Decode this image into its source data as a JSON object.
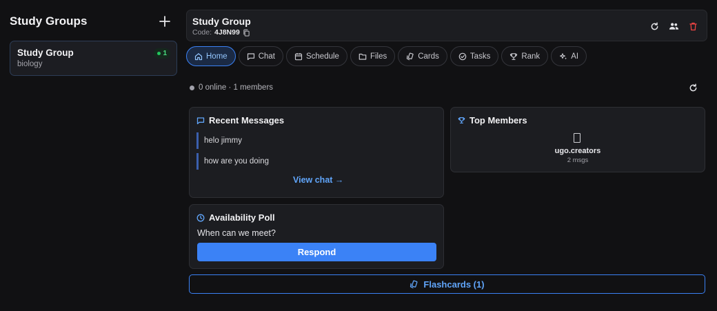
{
  "sidebar": {
    "title": "Study Groups",
    "add_icon": "plus-icon",
    "groups": [
      {
        "name": "Study Group",
        "subject": "biology",
        "online_count": "1"
      }
    ]
  },
  "header": {
    "title": "Study Group",
    "code_label": "Code:",
    "code_value": "4J8N99",
    "icons": [
      "refresh-icon",
      "members-icon",
      "trash-icon"
    ]
  },
  "tabs": [
    {
      "label": "Home",
      "icon": "home-icon",
      "active": true
    },
    {
      "label": "Chat",
      "icon": "chat-icon"
    },
    {
      "label": "Schedule",
      "icon": "calendar-icon"
    },
    {
      "label": "Files",
      "icon": "folder-icon"
    },
    {
      "label": "Cards",
      "icon": "cards-icon"
    },
    {
      "label": "Tasks",
      "icon": "check-circle-icon"
    },
    {
      "label": "Rank",
      "icon": "trophy-icon"
    },
    {
      "label": "AI",
      "icon": "sparkles-icon"
    }
  ],
  "status": {
    "text": "0 online · 1 members"
  },
  "recent_messages": {
    "title": "Recent Messages",
    "messages": [
      "helo jimmy",
      "how are you doing"
    ],
    "view_chat": "View chat →"
  },
  "top_members": {
    "title": "Top Members",
    "members": [
      {
        "name": "ugo.creators",
        "msgs": "2 msgs"
      }
    ]
  },
  "poll": {
    "title": "Availability Poll",
    "question": "When can we meet?",
    "respond_label": "Respond"
  },
  "flashcards": {
    "label": "Flashcards (1)"
  },
  "colors": {
    "accent": "#3b82f6",
    "background": "#111113",
    "card": "#1c1d21",
    "online": "#22c55e"
  }
}
